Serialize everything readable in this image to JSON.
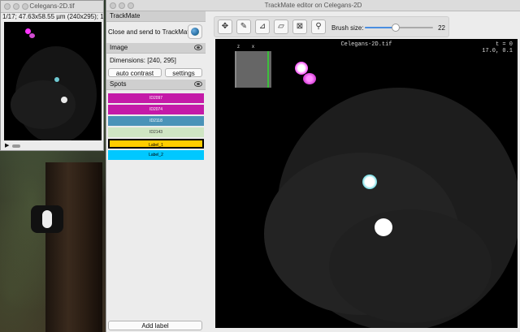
{
  "image_window": {
    "title": "Celegans-2D.tif",
    "info": "1/17; 47.63x58.55 µm (240x295); 16-"
  },
  "main_window": {
    "title": "TrackMate editor on Celegans-2D"
  },
  "sidebar": {
    "trackmate_header": "TrackMate",
    "close_send_label": "Close and send to TrackMate",
    "image_header": "Image",
    "dimensions": "Dimensions: [240, 295]",
    "auto_contrast": "auto contrast",
    "settings": "settings",
    "spots_header": "Spots",
    "spots": [
      {
        "label": "ID2097",
        "color": "#c41aa8",
        "text_color": "#ffffff"
      },
      {
        "label": "ID2074",
        "color": "#c41aa8",
        "text_color": "#ffffff"
      },
      {
        "label": "ID2118",
        "color": "#4a93b8",
        "text_color": "#ffffff"
      },
      {
        "label": "ID2143",
        "color": "#cfe6c3",
        "text_color": "#333333"
      },
      {
        "label": "Label_1",
        "color": "#ffcc00",
        "text_color": "#000000"
      },
      {
        "label": "Label_2",
        "color": "#00c8ff",
        "text_color": "#000000"
      }
    ],
    "add_label": "Add label"
  },
  "toolbar": {
    "tools": [
      "move-icon",
      "pencil-icon",
      "fill-icon",
      "eraser-icon",
      "clear-icon",
      "eyedropper-icon"
    ],
    "brush_label": "Brush size:",
    "brush_value": "22",
    "brush_fraction": 0.45
  },
  "canvas": {
    "title": "Celegans-2D.tif",
    "t_line": "t = 0",
    "t_value": "17.0,     0.1",
    "nav_z": "z",
    "nav_x": "x"
  },
  "colors": {
    "spot_magenta": "#e060e0",
    "spot_cyan": "#7fd8e0",
    "spot_white": "#ffffff"
  }
}
